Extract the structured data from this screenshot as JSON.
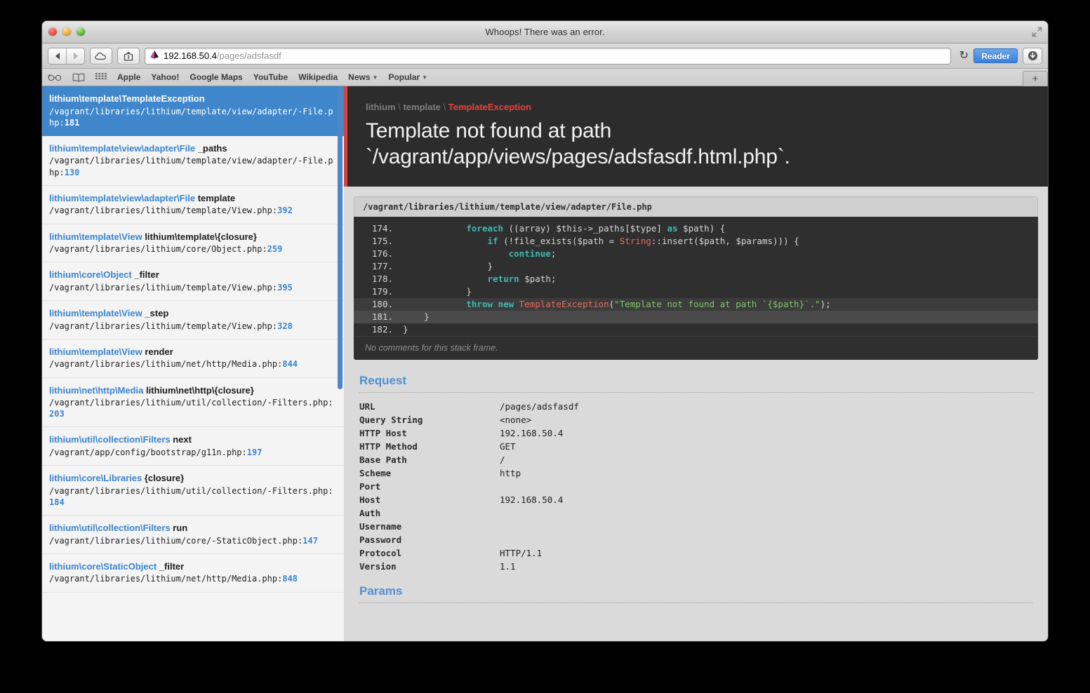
{
  "window": {
    "title": "Whoops! There was an error."
  },
  "toolbar": {
    "url_host": "192.168.50.4",
    "url_path": "/pages/adsfasdf",
    "reader_label": "Reader",
    "reload_glyph": "↻"
  },
  "bookmarks": {
    "items": [
      {
        "label": "Apple",
        "caret": false
      },
      {
        "label": "Yahoo!",
        "caret": false
      },
      {
        "label": "Google Maps",
        "caret": false
      },
      {
        "label": "YouTube",
        "caret": false
      },
      {
        "label": "Wikipedia",
        "caret": false
      },
      {
        "label": "News",
        "caret": true
      },
      {
        "label": "Popular",
        "caret": true
      }
    ],
    "newtab_label": "+"
  },
  "stack_frames": [
    {
      "class": "lithium\\template\\TemplateException",
      "method": "",
      "file": "/vagrant/libraries/lithium/template/view/adapter/-File.php",
      "line": "181",
      "selected": true
    },
    {
      "class": "lithium\\template\\view\\adapter\\File",
      "method": "_paths",
      "file": "/vagrant/libraries/lithium/template/view/adapter/-File.php",
      "line": "130",
      "selected": false
    },
    {
      "class": "lithium\\template\\view\\adapter\\File",
      "method": "template",
      "file": "/vagrant/libraries/lithium/template/View.php",
      "line": "392",
      "selected": false
    },
    {
      "class": "lithium\\template\\View",
      "method": "lithium\\template\\{closure}",
      "file": "/vagrant/libraries/lithium/core/Object.php",
      "line": "259",
      "selected": false
    },
    {
      "class": "lithium\\core\\Object",
      "method": "_filter",
      "file": "/vagrant/libraries/lithium/template/View.php",
      "line": "395",
      "selected": false
    },
    {
      "class": "lithium\\template\\View",
      "method": "_step",
      "file": "/vagrant/libraries/lithium/template/View.php",
      "line": "328",
      "selected": false
    },
    {
      "class": "lithium\\template\\View",
      "method": "render",
      "file": "/vagrant/libraries/lithium/net/http/Media.php",
      "line": "844",
      "selected": false
    },
    {
      "class": "lithium\\net\\http\\Media",
      "method": "lithium\\net\\http\\{closure}",
      "file": "/vagrant/libraries/lithium/util/collection/-Filters.php",
      "line": "203",
      "selected": false
    },
    {
      "class": "lithium\\util\\collection\\Filters",
      "method": "next",
      "file": "/vagrant/app/config/bootstrap/g11n.php",
      "line": "197",
      "selected": false
    },
    {
      "class": "lithium\\core\\Libraries",
      "method": "{closure}",
      "file": "/vagrant/libraries/lithium/util/collection/-Filters.php",
      "line": "184",
      "selected": false
    },
    {
      "class": "lithium\\util\\collection\\Filters",
      "method": "run",
      "file": "/vagrant/libraries/lithium/core/-StaticObject.php",
      "line": "147",
      "selected": false
    },
    {
      "class": "lithium\\core\\StaticObject",
      "method": "_filter",
      "file": "/vagrant/libraries/lithium/net/http/Media.php",
      "line": "848",
      "selected": false
    }
  ],
  "error": {
    "namespace_part1": "lithium",
    "namespace_part2": "template",
    "exception_class": "TemplateException",
    "message_line1": "Template not found at path",
    "message_line2": "`/vagrant/app/views/pages/adsfasdf.html.php`."
  },
  "code": {
    "file_path": "/vagrant/libraries/lithium/template/view/adapter/File.php",
    "comment": "No comments for this stack frame.",
    "lines": [
      {
        "num": "174.",
        "highlight": "none"
      },
      {
        "num": "175.",
        "highlight": "none"
      },
      {
        "num": "176.",
        "highlight": "none"
      },
      {
        "num": "177.",
        "highlight": "none"
      },
      {
        "num": "178.",
        "highlight": "none"
      },
      {
        "num": "179.",
        "highlight": "none"
      },
      {
        "num": "180.",
        "highlight": "dark"
      },
      {
        "num": "181.",
        "highlight": "light"
      },
      {
        "num": "182.",
        "highlight": "none"
      }
    ],
    "source_text": [
      "            foreach ((array) $this->_paths[$type] as $path) {",
      "                if (!file_exists($path = String::insert($path, $params))) {",
      "                    continue;",
      "                }",
      "                return $path;",
      "            }",
      "            throw new TemplateException(\"Template not found at path `{$path}`.\");",
      "    }",
      "}"
    ]
  },
  "request": {
    "title": "Request",
    "rows": [
      {
        "key": "URL",
        "value": "/pages/adsfasdf"
      },
      {
        "key": "Query String",
        "value": "<none>"
      },
      {
        "key": "HTTP Host",
        "value": "192.168.50.4"
      },
      {
        "key": "HTTP Method",
        "value": "GET"
      },
      {
        "key": "Base Path",
        "value": "/"
      },
      {
        "key": "Scheme",
        "value": "http"
      },
      {
        "key": "Port",
        "value": ""
      },
      {
        "key": "Host",
        "value": "192.168.50.4"
      },
      {
        "key": "Auth",
        "value": ""
      },
      {
        "key": "Username",
        "value": ""
      },
      {
        "key": "Password",
        "value": ""
      },
      {
        "key": "Protocol",
        "value": "HTTP/1.1"
      },
      {
        "key": "Version",
        "value": "1.1"
      }
    ]
  },
  "params": {
    "title": "Params"
  },
  "colors": {
    "accent_blue": "#3f86cb",
    "error_red": "#d9433f",
    "code_bg": "#2f2f2f",
    "header_bg": "#2c2c2c"
  }
}
